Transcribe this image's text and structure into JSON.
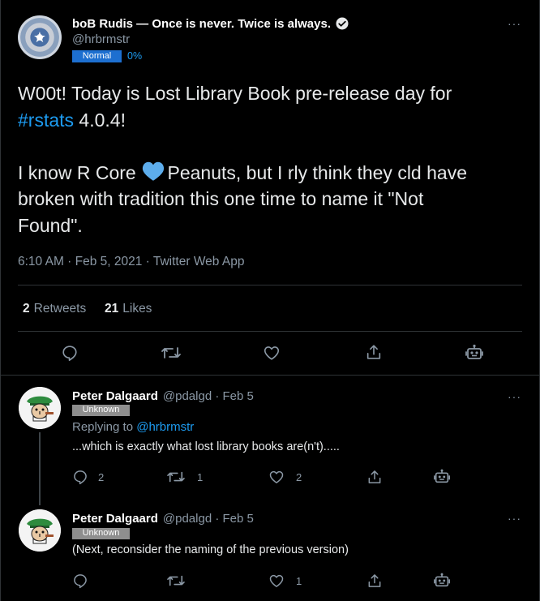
{
  "main_tweet": {
    "author_name": "boB Rudis — Once is never. Twice is always.",
    "handle": "@hrbrmstr",
    "badge": "Normal",
    "badge_pct": "0%",
    "text_line1": "W00t! Today is Lost Library Book pre-release day for",
    "hashtag": "#rstats",
    "text_line2_rest": " 4.0.4!",
    "text_para2_a": "I know R Core ",
    "text_para2_b": " Peanuts, but I rly think they cld have",
    "text_para2_line2": "broken with tradition this one time to name it \"Not",
    "text_para2_line3": "Found\".",
    "timestamp": "6:10 AM · Feb 5, 2021 · Twitter Web App",
    "retweets_count": "2",
    "retweets_label": "Retweets",
    "likes_count": "21",
    "likes_label": "Likes"
  },
  "replies": [
    {
      "name": "Peter Dalgaard",
      "handle_date": "@pdalgd · Feb 5",
      "badge": "Unknown",
      "replying_prefix": "Replying to ",
      "replying_to": "@hrbrmstr",
      "text": "...which is exactly what lost library books are(n't).....",
      "reply_count": "2",
      "retweet_count": "1",
      "like_count": "2"
    },
    {
      "name": "Peter Dalgaard",
      "handle_date": "@pdalgd · Feb 5",
      "badge": "Unknown",
      "text": "(Next, reconsider the naming of the previous version)",
      "like_count": "1"
    }
  ],
  "more_icon": "···",
  "colors": {
    "background": "#000000",
    "accent": "#1d9bf0",
    "badge_normal": "#1d6fd0",
    "badge_unknown": "#8e8e8e",
    "muted_text": "#8b98a5"
  },
  "icons": [
    "verified-icon",
    "reply-icon",
    "retweet-icon",
    "like-icon",
    "share-icon",
    "bot-icon",
    "more-icon",
    "heart-emoji"
  ]
}
